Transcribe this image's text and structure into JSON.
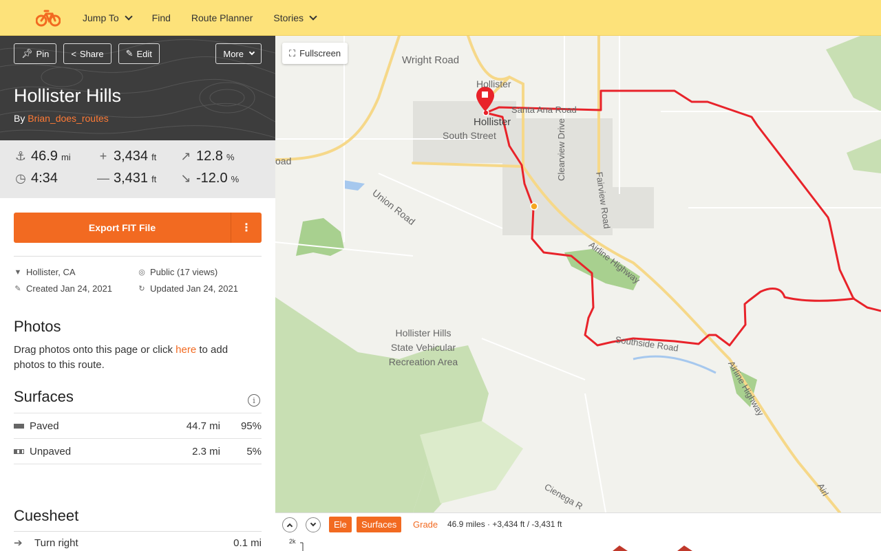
{
  "nav": {
    "items": [
      {
        "label": "Jump To",
        "dropdown": true
      },
      {
        "label": "Find",
        "dropdown": false
      },
      {
        "label": "Route Planner",
        "dropdown": false
      },
      {
        "label": "Stories",
        "dropdown": true
      }
    ],
    "brand_color": "#f26a21",
    "bar_color": "#fde27a"
  },
  "hero": {
    "buttons": {
      "pin": "Pin",
      "share": "Share",
      "edit": "Edit",
      "more": "More"
    },
    "title": "Hollister Hills",
    "by_prefix": "By",
    "author": "Brian_does_routes"
  },
  "stats": {
    "distance": {
      "value": "46.9",
      "unit": "mi"
    },
    "moving_time": {
      "value": "4:34"
    },
    "elev_gain": {
      "value": "3,434",
      "unit": "ft"
    },
    "elev_loss": {
      "value": "3,431",
      "unit": "ft"
    },
    "max_grade": {
      "value": "12.8",
      "unit": "%"
    },
    "min_grade": {
      "value": "-12.0",
      "unit": "%"
    }
  },
  "export": {
    "label": "Export FIT File"
  },
  "meta": {
    "location": "Hollister, CA",
    "visibility": "Public (17 views)",
    "created": "Created Jan 24, 2021",
    "updated": "Updated Jan 24, 2021"
  },
  "photos": {
    "heading": "Photos",
    "text_before": "Drag photos onto this page or click ",
    "link": "here",
    "text_after": " to add photos to this route."
  },
  "surfaces": {
    "heading": "Surfaces",
    "rows": [
      {
        "name": "Paved",
        "distance": "44.7 mi",
        "percent": "95%"
      },
      {
        "name": "Unpaved",
        "distance": "2.3 mi",
        "percent": "5%"
      }
    ]
  },
  "cuesheet": {
    "heading": "Cuesheet",
    "first": {
      "instruction": "Turn right",
      "distance": "0.1 mi"
    }
  },
  "map": {
    "fullscreen_label": "Fullscreen",
    "labels": {
      "wright_road": "Wright Road",
      "hollister_small": "Hollister",
      "hollister": "Hollister",
      "santa_ana": "Santa Ana Road",
      "south_street": "South Street",
      "union_road": "Union Road",
      "clearview": "Clearview Drive",
      "fairview": "Fairview Road",
      "airline1": "Airline Highway",
      "airline2": "Airline Highway",
      "airline3": "Airl",
      "southside": "Southside Road",
      "park": "Hollister Hills State Vehicular Recreation Area",
      "cienega": "Cienega R",
      "road_left": "oad"
    },
    "route_color": "#e8232a"
  },
  "elevation": {
    "tab_ele": "Ele",
    "tab_surfaces": "Surfaces",
    "tab_grade": "Grade",
    "summary": "46.9 miles · +3,434 ft / -3,431 ft",
    "y_tick": "2k"
  }
}
